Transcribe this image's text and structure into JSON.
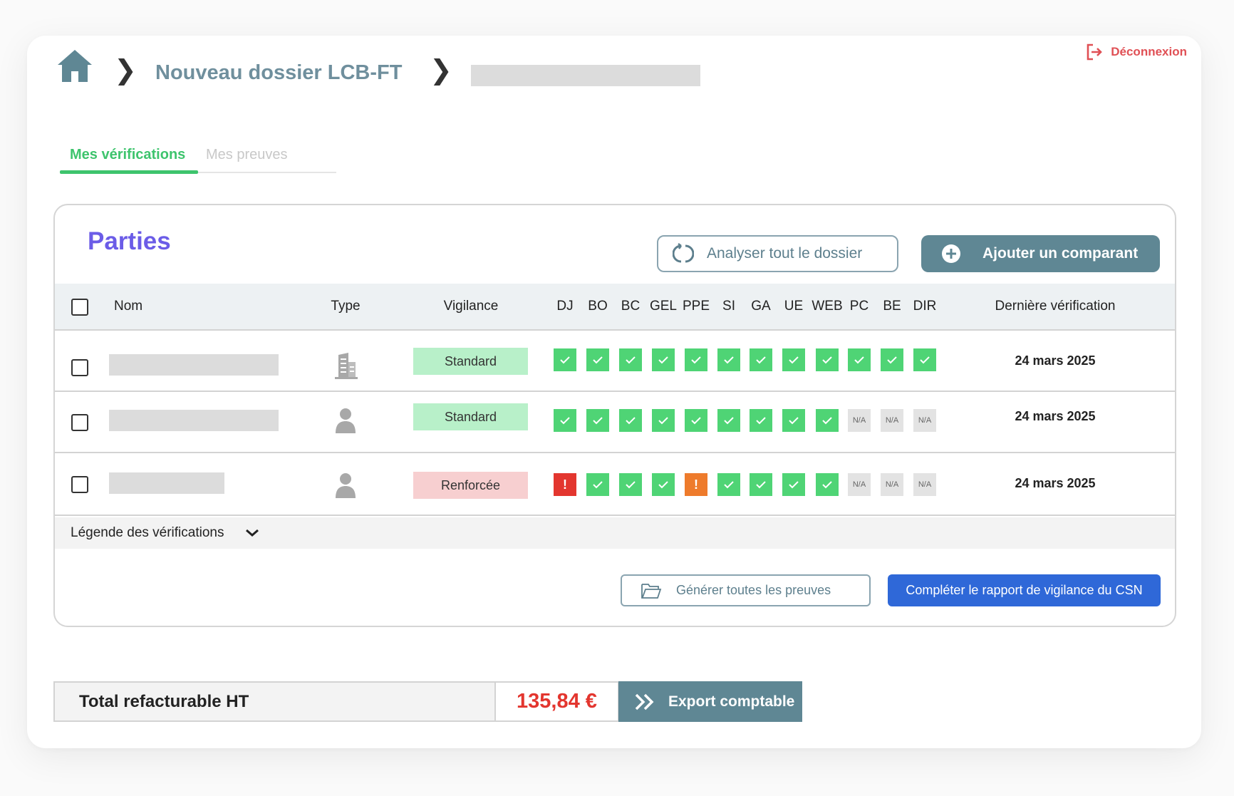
{
  "header": {
    "breadcrumb_title": "Nouveau dossier LCB-FT",
    "logout_label": "Déconnexion"
  },
  "tabs": [
    {
      "label": "Mes vérifications",
      "active": true
    },
    {
      "label": "Mes preuves",
      "active": false
    }
  ],
  "parties": {
    "title": "Parties",
    "analyze_label": "Analyser tout le dossier",
    "add_label": "Ajouter un comparant",
    "columns": {
      "name": "Nom",
      "type": "Type",
      "vigilance": "Vigilance",
      "checks": [
        "DJ",
        "BO",
        "BC",
        "GEL",
        "PPE",
        "SI",
        "GA",
        "UE",
        "WEB",
        "PC",
        "BE",
        "DIR"
      ],
      "last_check": "Dernière vérification"
    },
    "rows": [
      {
        "type_icon": "building-icon",
        "vigilance": "Standard",
        "checks": [
          "ok",
          "ok",
          "ok",
          "ok",
          "ok",
          "ok",
          "ok",
          "ok",
          "ok",
          "ok",
          "ok",
          "ok"
        ],
        "last_check": "24 mars 2025"
      },
      {
        "type_icon": "person-icon",
        "vigilance": "Standard",
        "checks": [
          "ok",
          "ok",
          "ok",
          "ok",
          "ok",
          "ok",
          "ok",
          "ok",
          "ok",
          "na",
          "na",
          "na"
        ],
        "last_check": "24 mars 2025"
      },
      {
        "type_icon": "person-icon",
        "vigilance": "Renforcée",
        "checks": [
          "alert-red",
          "ok",
          "ok",
          "ok",
          "alert-orange",
          "ok",
          "ok",
          "ok",
          "ok",
          "na",
          "na",
          "na"
        ],
        "last_check": "24 mars 2025"
      }
    ],
    "na_label": "N/A",
    "alert_label": "!",
    "legend_label": "Légende des vérifications",
    "generate_label": "Générer toutes les preuves",
    "csn_label": "Compléter le rapport de vigilance du CSN"
  },
  "footer": {
    "total_label": "Total refacturable HT",
    "total_amount": "135,84 €",
    "export_label": "Export comptable"
  },
  "colors": {
    "accent_green": "#3ec46d",
    "title_purple": "#6b5ce7",
    "slate": "#5f8794",
    "check_ok": "#4fd475",
    "alert_red": "#e3362f",
    "alert_orange": "#ee7b2c",
    "primary_blue": "#2f68d8",
    "logout_red": "#e05055"
  }
}
